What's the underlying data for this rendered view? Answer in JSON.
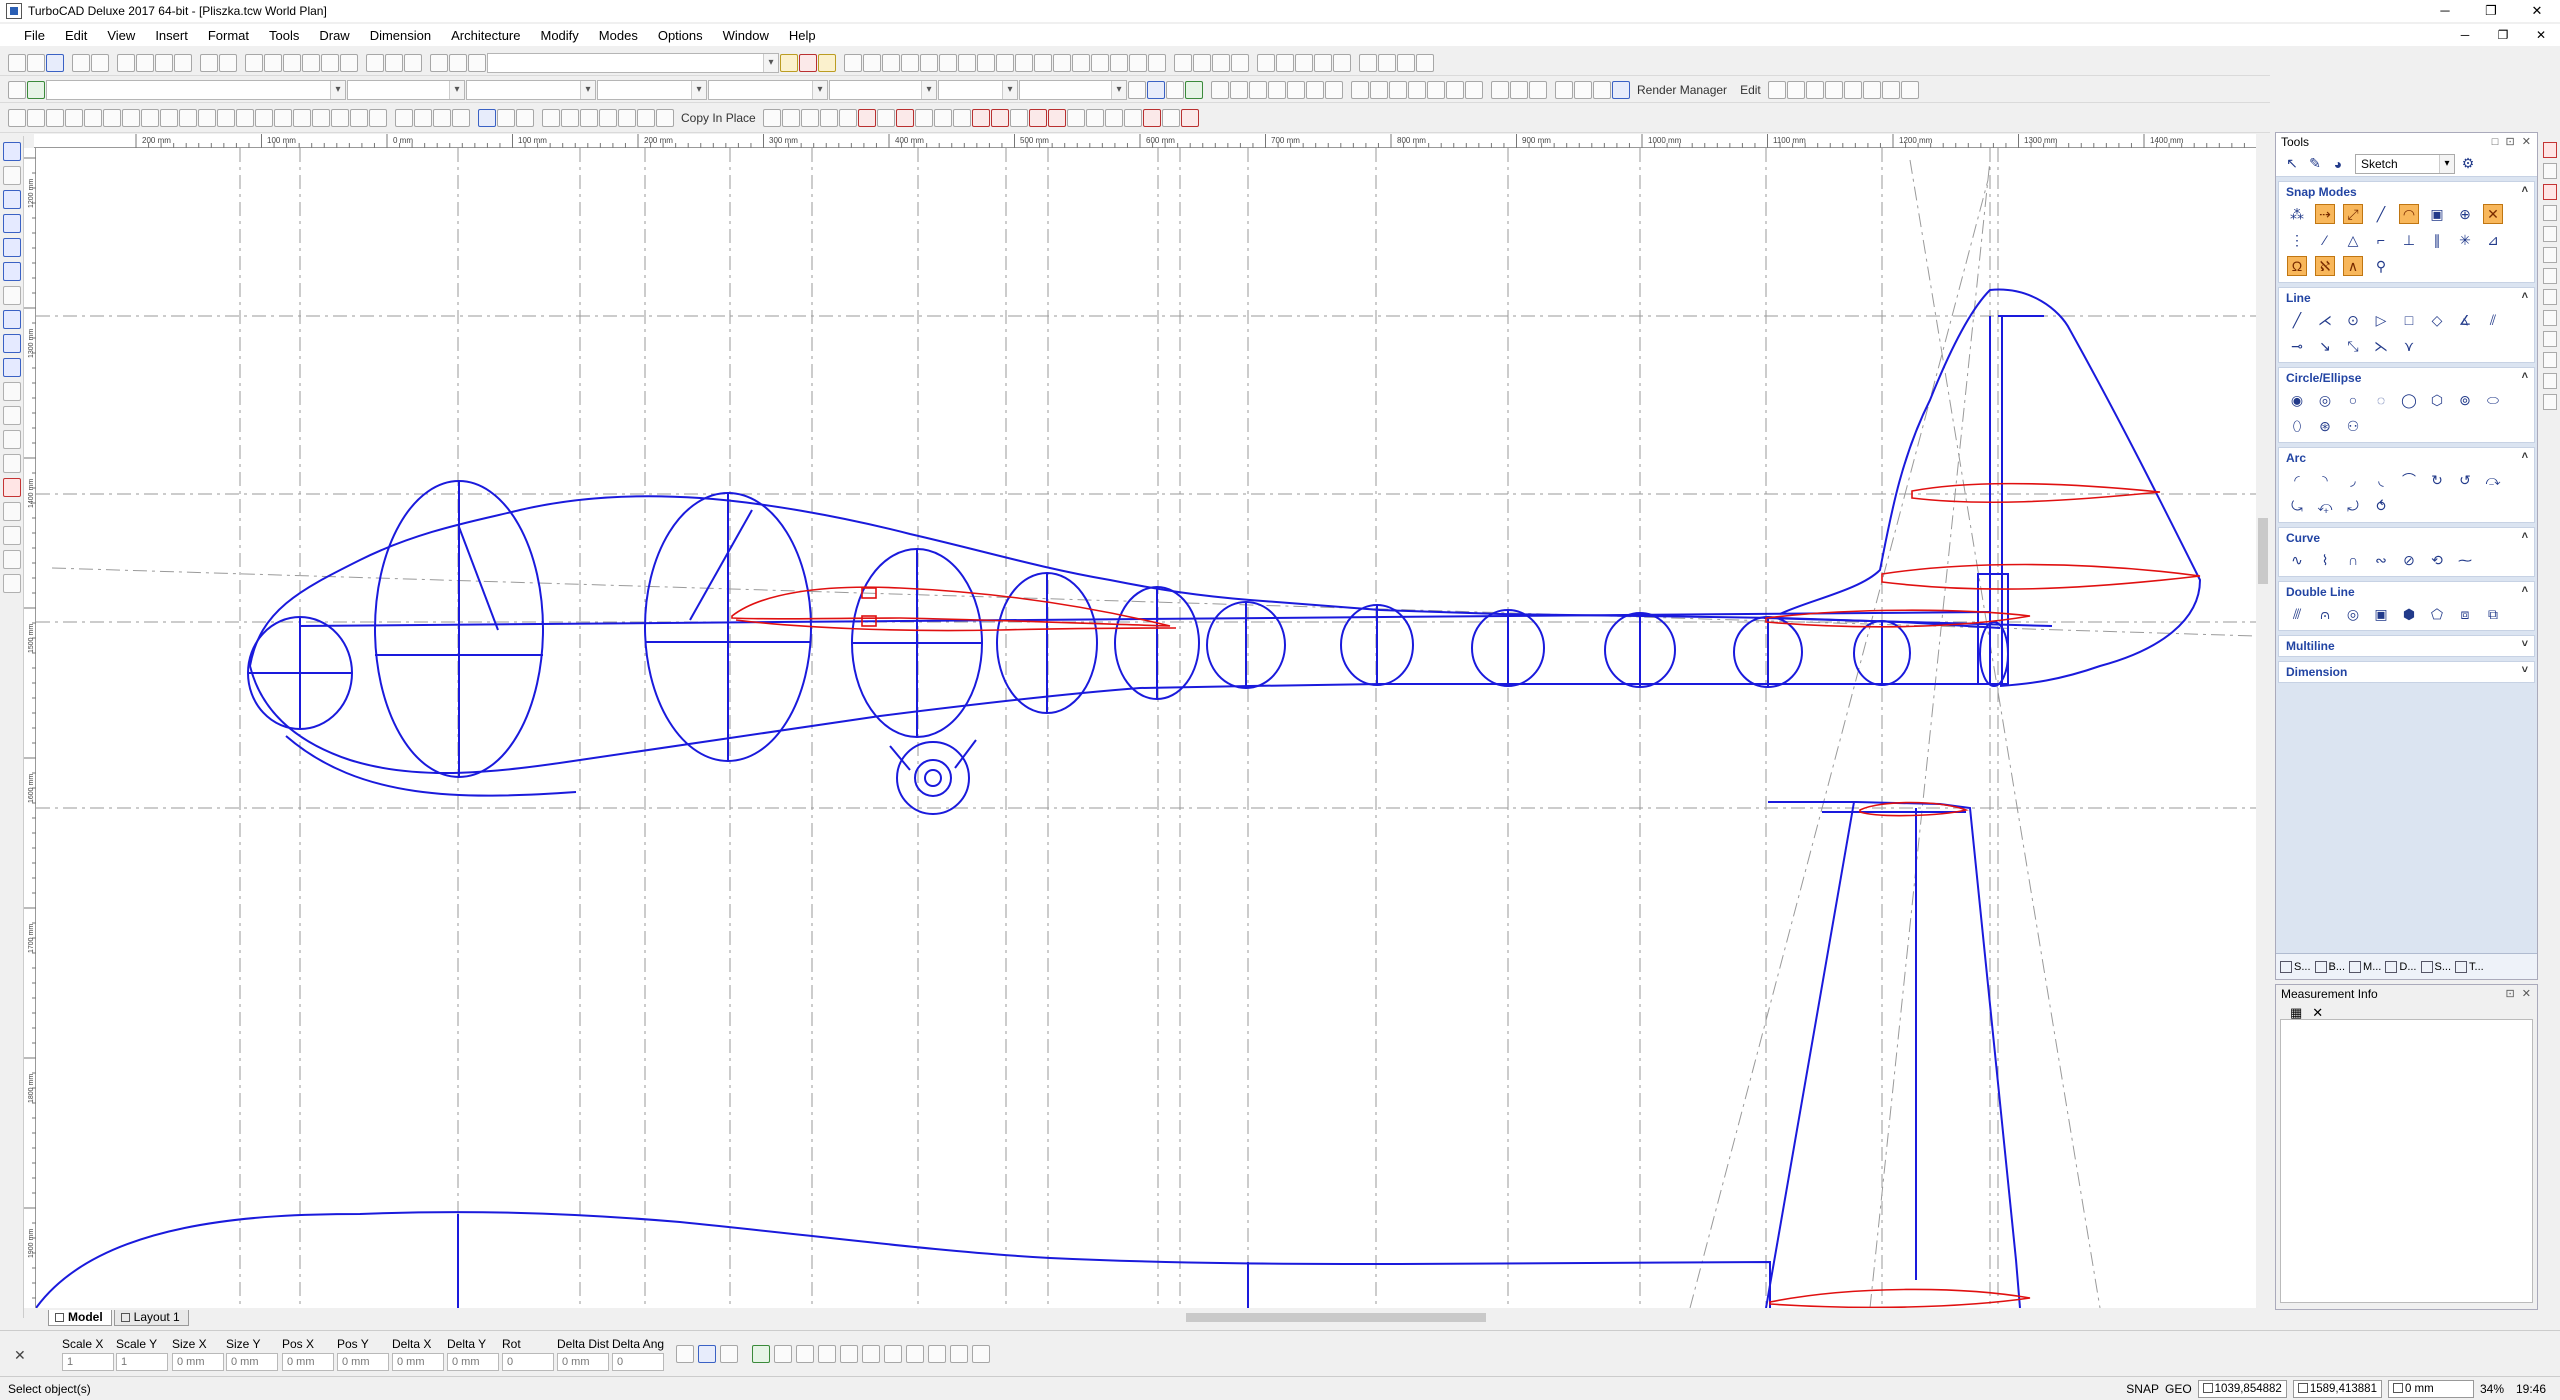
{
  "window": {
    "title": "TurboCAD Deluxe 2017 64-bit - [Pliszka.tcw World Plan]",
    "minimize": "─",
    "maximize": "❐",
    "close": "✕"
  },
  "menu": [
    "File",
    "Edit",
    "View",
    "Insert",
    "Format",
    "Tools",
    "Draw",
    "Dimension",
    "Architecture",
    "Modify",
    "Modes",
    "Options",
    "Window",
    "Help"
  ],
  "mdi_controls": {
    "minimize": "─",
    "restore": "❐",
    "close": "✕"
  },
  "toolbar": {
    "copy_in_place": "Copy In Place",
    "render_manager": "Render Manager",
    "edit": "Edit"
  },
  "ruler": {
    "top": [
      "200 mm",
      "100 mm",
      "0 mm",
      "100 mm",
      "200 mm",
      "300 mm",
      "400 mm",
      "500 mm",
      "600 mm",
      "700 mm",
      "800 mm",
      "900 mm",
      "1000 mm",
      "1100 mm",
      "1200 mm",
      "1300 mm",
      "1400 mm"
    ],
    "left": [
      "1200 mm",
      "1300 mm",
      "1400 mm",
      "1500 mm",
      "1600 mm",
      "1700 mm",
      "1800 mm",
      "1900 mm"
    ]
  },
  "tabs": {
    "model": "Model",
    "layout": "Layout 1"
  },
  "inspector": {
    "close": "✕",
    "fields": [
      {
        "label": "Scale X",
        "value": "1"
      },
      {
        "label": "Scale Y",
        "value": "1"
      },
      {
        "label": "Size X",
        "value": "0 mm"
      },
      {
        "label": "Size Y",
        "value": "0 mm"
      },
      {
        "label": "Pos X",
        "value": "0 mm"
      },
      {
        "label": "Pos Y",
        "value": "0 mm"
      },
      {
        "label": "Delta X",
        "value": "0 mm"
      },
      {
        "label": "Delta Y",
        "value": "0 mm"
      },
      {
        "label": "Rot",
        "value": "0"
      },
      {
        "label": "Delta Dist",
        "value": "0 mm"
      },
      {
        "label": "Delta Ang",
        "value": "0"
      }
    ]
  },
  "status": {
    "message": "Select object(s)",
    "snap": "SNAP",
    "geo": "GEO",
    "coord_x": "1039,854882",
    "coord_y": "1589,413881",
    "length": "0 mm",
    "zoom": "34%",
    "time": "19:46"
  },
  "tools_palette": {
    "title": "Tools",
    "mode": "Sketch",
    "sections": [
      {
        "title": "Snap Modes",
        "expanded": true
      },
      {
        "title": "Line",
        "expanded": true
      },
      {
        "title": "Circle/Ellipse",
        "expanded": true
      },
      {
        "title": "Arc",
        "expanded": true
      },
      {
        "title": "Curve",
        "expanded": true
      },
      {
        "title": "Double Line",
        "expanded": true
      },
      {
        "title": "Multiline",
        "expanded": false
      },
      {
        "title": "Dimension",
        "expanded": false
      }
    ],
    "chevron_up": "˄",
    "chevron_down": "˅",
    "bottom_tabs": [
      "S...",
      "B...",
      "M...",
      "D...",
      "S...",
      "T..."
    ]
  },
  "measurement_info": {
    "title": "Measurement Info",
    "close": "✕"
  },
  "colors": {
    "geometry": "#1a1adc",
    "airfoil": "#e01010",
    "guide": "#9a9a9a",
    "snap_active": "#f8b75b"
  }
}
